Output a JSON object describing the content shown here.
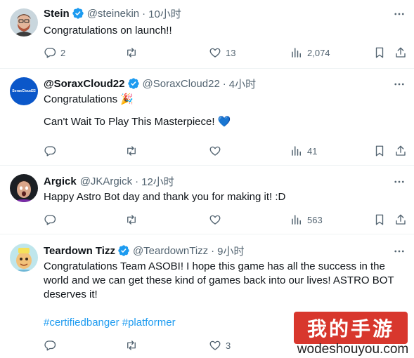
{
  "tweets": [
    {
      "name": "Stein",
      "handle": "@steinekin",
      "time": "10小时",
      "lines": [
        "Congratulations on launch!!"
      ],
      "replies": "2",
      "retweets": "",
      "likes": "13",
      "views": "2,074"
    },
    {
      "name": "@SoraxCloud22",
      "handle": "@SoraxCloud22",
      "time": "4小时",
      "avatar_text": "SoraxCloud22",
      "lines": [
        "Congratulations 🎉",
        "",
        "Can't Wait To Play This Masterpiece! 💙"
      ],
      "replies": "",
      "retweets": "",
      "likes": "",
      "views": "41"
    },
    {
      "name": "Argick",
      "handle": "@JKArgick",
      "time": "12小时",
      "lines": [
        "Happy Astro Bot day and thank you for making it! :D"
      ],
      "replies": "",
      "retweets": "",
      "likes": "",
      "views": "563"
    },
    {
      "name": "Teardown Tizz",
      "handle": "@TeardownTizz",
      "time": "9小时",
      "lines": [
        "Congratulations Team ASOBI! I hope this game has all the success in the",
        "world and we can get these kind of games back into our lives! ASTRO BOT",
        "deserves it!"
      ],
      "hashtags": "#certifiedbanger #platformer",
      "replies": "",
      "retweets": "",
      "likes": "3",
      "views": ""
    }
  ],
  "separator": "·",
  "watermark": {
    "badge": "我的手游",
    "site": "wodeshouyou.com"
  },
  "colors": {
    "verified": "#1d9bf0",
    "muted": "#536471",
    "link": "#1d9bf0",
    "divider": "#eff3f4"
  }
}
